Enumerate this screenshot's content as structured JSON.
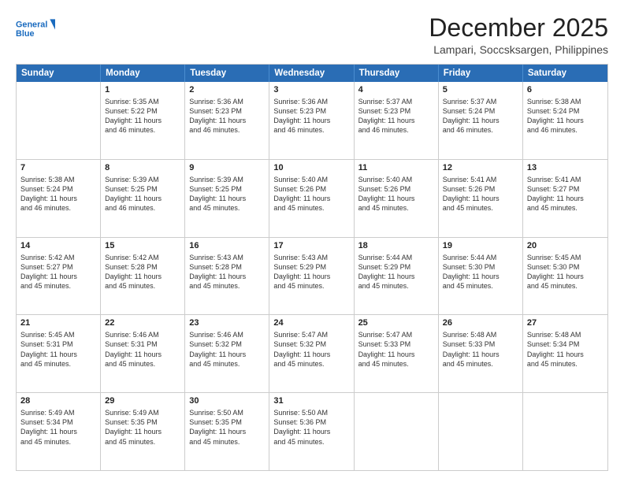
{
  "logo": {
    "line1": "General",
    "line2": "Blue"
  },
  "title": "December 2025",
  "subtitle": "Lampari, Soccsksargen, Philippines",
  "header_days": [
    "Sunday",
    "Monday",
    "Tuesday",
    "Wednesday",
    "Thursday",
    "Friday",
    "Saturday"
  ],
  "weeks": [
    [
      {
        "day": "",
        "info": ""
      },
      {
        "day": "1",
        "info": "Sunrise: 5:35 AM\nSunset: 5:22 PM\nDaylight: 11 hours\nand 46 minutes."
      },
      {
        "day": "2",
        "info": "Sunrise: 5:36 AM\nSunset: 5:23 PM\nDaylight: 11 hours\nand 46 minutes."
      },
      {
        "day": "3",
        "info": "Sunrise: 5:36 AM\nSunset: 5:23 PM\nDaylight: 11 hours\nand 46 minutes."
      },
      {
        "day": "4",
        "info": "Sunrise: 5:37 AM\nSunset: 5:23 PM\nDaylight: 11 hours\nand 46 minutes."
      },
      {
        "day": "5",
        "info": "Sunrise: 5:37 AM\nSunset: 5:24 PM\nDaylight: 11 hours\nand 46 minutes."
      },
      {
        "day": "6",
        "info": "Sunrise: 5:38 AM\nSunset: 5:24 PM\nDaylight: 11 hours\nand 46 minutes."
      }
    ],
    [
      {
        "day": "7",
        "info": "Sunrise: 5:38 AM\nSunset: 5:24 PM\nDaylight: 11 hours\nand 46 minutes."
      },
      {
        "day": "8",
        "info": "Sunrise: 5:39 AM\nSunset: 5:25 PM\nDaylight: 11 hours\nand 46 minutes."
      },
      {
        "day": "9",
        "info": "Sunrise: 5:39 AM\nSunset: 5:25 PM\nDaylight: 11 hours\nand 45 minutes."
      },
      {
        "day": "10",
        "info": "Sunrise: 5:40 AM\nSunset: 5:26 PM\nDaylight: 11 hours\nand 45 minutes."
      },
      {
        "day": "11",
        "info": "Sunrise: 5:40 AM\nSunset: 5:26 PM\nDaylight: 11 hours\nand 45 minutes."
      },
      {
        "day": "12",
        "info": "Sunrise: 5:41 AM\nSunset: 5:26 PM\nDaylight: 11 hours\nand 45 minutes."
      },
      {
        "day": "13",
        "info": "Sunrise: 5:41 AM\nSunset: 5:27 PM\nDaylight: 11 hours\nand 45 minutes."
      }
    ],
    [
      {
        "day": "14",
        "info": "Sunrise: 5:42 AM\nSunset: 5:27 PM\nDaylight: 11 hours\nand 45 minutes."
      },
      {
        "day": "15",
        "info": "Sunrise: 5:42 AM\nSunset: 5:28 PM\nDaylight: 11 hours\nand 45 minutes."
      },
      {
        "day": "16",
        "info": "Sunrise: 5:43 AM\nSunset: 5:28 PM\nDaylight: 11 hours\nand 45 minutes."
      },
      {
        "day": "17",
        "info": "Sunrise: 5:43 AM\nSunset: 5:29 PM\nDaylight: 11 hours\nand 45 minutes."
      },
      {
        "day": "18",
        "info": "Sunrise: 5:44 AM\nSunset: 5:29 PM\nDaylight: 11 hours\nand 45 minutes."
      },
      {
        "day": "19",
        "info": "Sunrise: 5:44 AM\nSunset: 5:30 PM\nDaylight: 11 hours\nand 45 minutes."
      },
      {
        "day": "20",
        "info": "Sunrise: 5:45 AM\nSunset: 5:30 PM\nDaylight: 11 hours\nand 45 minutes."
      }
    ],
    [
      {
        "day": "21",
        "info": "Sunrise: 5:45 AM\nSunset: 5:31 PM\nDaylight: 11 hours\nand 45 minutes."
      },
      {
        "day": "22",
        "info": "Sunrise: 5:46 AM\nSunset: 5:31 PM\nDaylight: 11 hours\nand 45 minutes."
      },
      {
        "day": "23",
        "info": "Sunrise: 5:46 AM\nSunset: 5:32 PM\nDaylight: 11 hours\nand 45 minutes."
      },
      {
        "day": "24",
        "info": "Sunrise: 5:47 AM\nSunset: 5:32 PM\nDaylight: 11 hours\nand 45 minutes."
      },
      {
        "day": "25",
        "info": "Sunrise: 5:47 AM\nSunset: 5:33 PM\nDaylight: 11 hours\nand 45 minutes."
      },
      {
        "day": "26",
        "info": "Sunrise: 5:48 AM\nSunset: 5:33 PM\nDaylight: 11 hours\nand 45 minutes."
      },
      {
        "day": "27",
        "info": "Sunrise: 5:48 AM\nSunset: 5:34 PM\nDaylight: 11 hours\nand 45 minutes."
      }
    ],
    [
      {
        "day": "28",
        "info": "Sunrise: 5:49 AM\nSunset: 5:34 PM\nDaylight: 11 hours\nand 45 minutes."
      },
      {
        "day": "29",
        "info": "Sunrise: 5:49 AM\nSunset: 5:35 PM\nDaylight: 11 hours\nand 45 minutes."
      },
      {
        "day": "30",
        "info": "Sunrise: 5:50 AM\nSunset: 5:35 PM\nDaylight: 11 hours\nand 45 minutes."
      },
      {
        "day": "31",
        "info": "Sunrise: 5:50 AM\nSunset: 5:36 PM\nDaylight: 11 hours\nand 45 minutes."
      },
      {
        "day": "",
        "info": ""
      },
      {
        "day": "",
        "info": ""
      },
      {
        "day": "",
        "info": ""
      }
    ]
  ]
}
